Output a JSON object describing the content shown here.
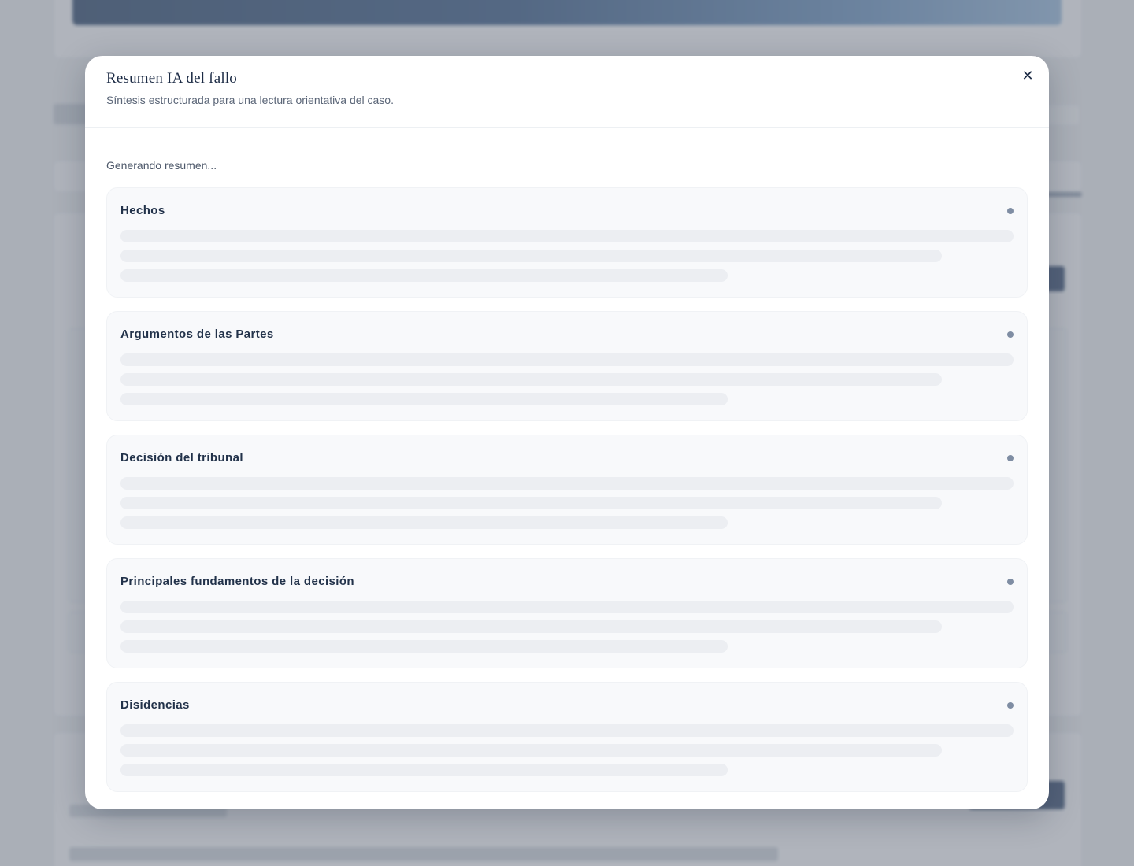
{
  "modal": {
    "title": "Resumen IA del fallo",
    "subtitle": "Síntesis estructurada para una lectura orientativa del caso.",
    "close_icon": "close-icon",
    "status": "Generando resumen...",
    "sections": [
      {
        "title": "Hechos"
      },
      {
        "title": "Argumentos de las Partes"
      },
      {
        "title": "Decisión del tribunal"
      },
      {
        "title": "Principales fundamentos de la decisión"
      },
      {
        "title": "Disidencias"
      }
    ]
  },
  "colors": {
    "overlay": "#767e8a",
    "modal_bg": "#ffffff",
    "section_bg": "#f8f9fb",
    "skeleton": "#eceef2",
    "title_text": "#1c2b45",
    "status_dot": "#7f8da3"
  }
}
